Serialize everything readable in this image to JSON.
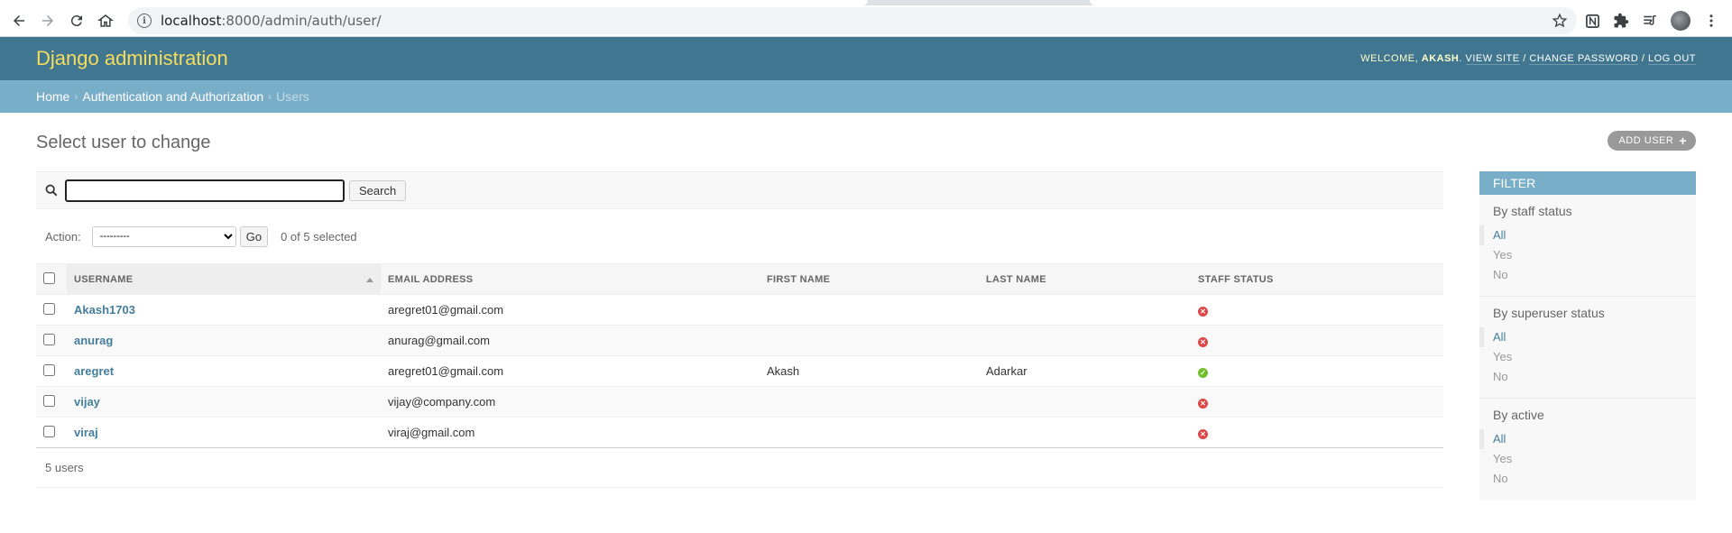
{
  "browser": {
    "url_host": "localhost",
    "url_path": ":8000/admin/auth/user/"
  },
  "header": {
    "brand": "Django administration",
    "welcome": "WELCOME,",
    "username": "AKASH",
    "view_site": "VIEW SITE",
    "change_password": "CHANGE PASSWORD",
    "log_out": "LOG OUT"
  },
  "breadcrumbs": {
    "home": "Home",
    "app": "Authentication and Authorization",
    "current": "Users"
  },
  "page": {
    "title": "Select user to change",
    "add_button": "ADD USER"
  },
  "search": {
    "value": "",
    "button": "Search"
  },
  "actions": {
    "label": "Action:",
    "selected_option": "---------",
    "go": "Go",
    "count": "0 of 5 selected"
  },
  "table": {
    "columns": [
      "USERNAME",
      "EMAIL ADDRESS",
      "FIRST NAME",
      "LAST NAME",
      "STAFF STATUS"
    ],
    "rows": [
      {
        "username": "Akash1703",
        "email": "aregret01@gmail.com",
        "first_name": "",
        "last_name": "",
        "staff": false
      },
      {
        "username": "anurag",
        "email": "anurag@gmail.com",
        "first_name": "",
        "last_name": "",
        "staff": false
      },
      {
        "username": "aregret",
        "email": "aregret01@gmail.com",
        "first_name": "Akash",
        "last_name": "Adarkar",
        "staff": true
      },
      {
        "username": "vijay",
        "email": "vijay@company.com",
        "first_name": "",
        "last_name": "",
        "staff": false
      },
      {
        "username": "viraj",
        "email": "viraj@gmail.com",
        "first_name": "",
        "last_name": "",
        "staff": false
      }
    ]
  },
  "paginator": "5 users",
  "filter": {
    "title": "FILTER",
    "groups": [
      {
        "title": "By staff status",
        "options": [
          "All",
          "Yes",
          "No"
        ]
      },
      {
        "title": "By superuser status",
        "options": [
          "All",
          "Yes",
          "No"
        ]
      },
      {
        "title": "By active",
        "options": [
          "All",
          "Yes",
          "No"
        ]
      }
    ]
  },
  "colors": {
    "header_bg": "#417690",
    "brand": "#f5dd5d",
    "breadcrumb_bg": "#79aec8",
    "link": "#447e9b",
    "status_no": "#dd4646",
    "status_yes": "#70bf2b"
  }
}
